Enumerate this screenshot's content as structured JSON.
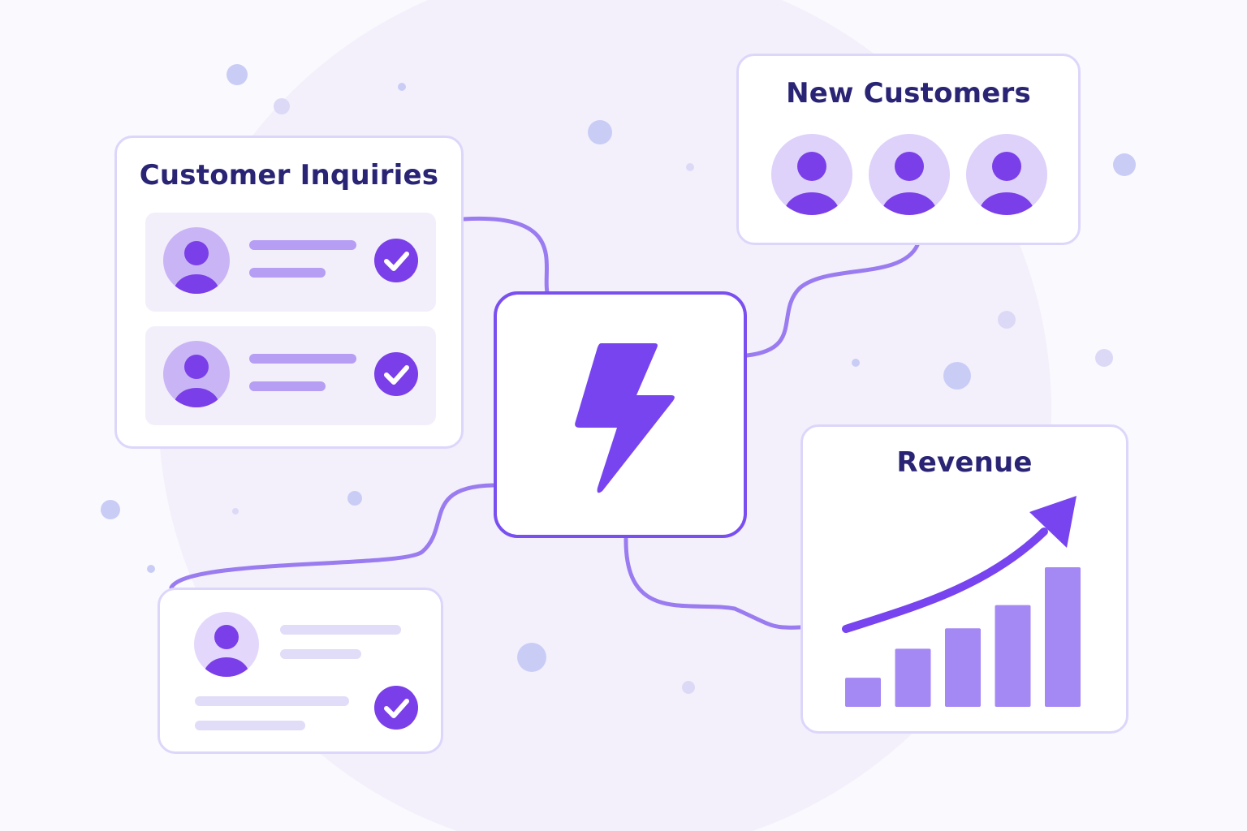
{
  "colors": {
    "accent": "#7744f0",
    "title": "#2a2475",
    "avatar_bg": "#c9b5f5",
    "avatar_person": "#7a3fe8",
    "connector": "#9a7cf0",
    "bar": "#a489f4"
  },
  "hub": {
    "icon": "lightning-bolt-icon"
  },
  "inquiries": {
    "title": "Customer Inquiries",
    "rows": [
      {
        "icon": "user-avatar-icon",
        "status_icon": "checkmark-icon"
      },
      {
        "icon": "user-avatar-icon",
        "status_icon": "checkmark-icon"
      }
    ]
  },
  "new_customers": {
    "title": "New Customers",
    "avatars": [
      "user-avatar-icon",
      "user-avatar-icon",
      "user-avatar-icon"
    ]
  },
  "revenue": {
    "title": "Revenue",
    "trend_icon": "trend-up-arrow-icon",
    "chart_data": {
      "type": "bar",
      "values": [
        1,
        2,
        2.7,
        3.5,
        4.8
      ],
      "trend": "up"
    }
  },
  "profile_card": {
    "icon": "user-avatar-icon",
    "status_icon": "checkmark-icon"
  }
}
